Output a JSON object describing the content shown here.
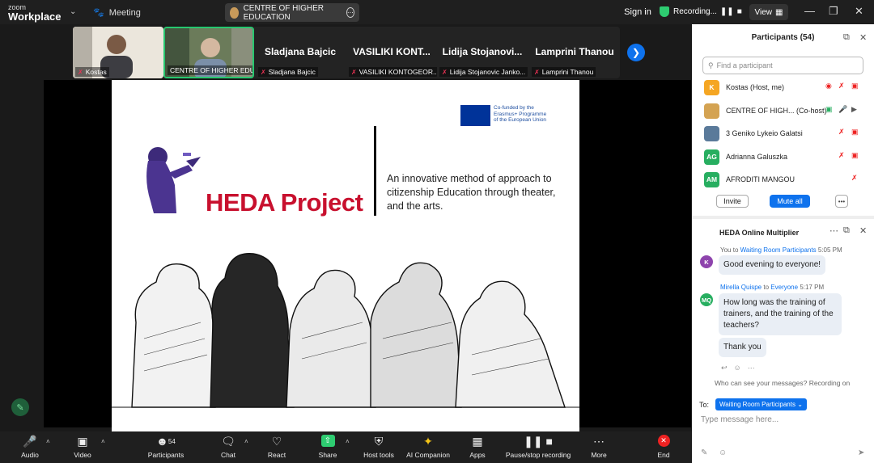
{
  "titlebar": {
    "brand_small": "zoom",
    "brand_big": "Workplace",
    "meeting_label": "Meeting",
    "tab_title": "CENTRE OF HIGHER EDUCATION",
    "sign_in": "Sign in",
    "recording": "Recording...",
    "view": "View"
  },
  "gallery": {
    "tiles": [
      {
        "name": "Kostas"
      },
      {
        "name": "CENTRE OF HIGHER EDU..."
      },
      {
        "label": "Sladjana Bajcic",
        "name": "Sladjana Bajcic"
      },
      {
        "label": "VASILIKI  KONT...",
        "name": "VASILIKI KONTOGEOR..."
      },
      {
        "label": "Lidija  Stojanovi...",
        "name": "Lidija Stojanovic Janko..."
      },
      {
        "label": "Lamprini Thanou",
        "name": "Lamprini Thanou"
      }
    ]
  },
  "slide": {
    "eu_text": [
      "Co-funded by the",
      "Erasmus+ Programme",
      "of the European Union"
    ],
    "title": "HEDA Project",
    "tagline": "An innovative method of approach to citizenship Education through theater, and the arts."
  },
  "participants": {
    "title": "Participants (54)",
    "search_placeholder": "Find a participant",
    "rows": [
      {
        "initials": "K",
        "name": "Kostas  (Host, me)",
        "color": "#f5a623"
      },
      {
        "initials": "",
        "name": "CENTRE OF HIGH...  (Co-host)",
        "color": "#d4a352"
      },
      {
        "initials": "",
        "name": "3 Geniko Lykeio Galatsi",
        "color": "#5a7a9a"
      },
      {
        "initials": "AG",
        "name": "Adrianna Galuszka",
        "color": "#27ae60"
      },
      {
        "initials": "AM",
        "name": "AFRODITI MANGOU",
        "color": "#27ae60"
      }
    ],
    "invite": "Invite",
    "mute_all": "Mute all",
    "more": "•••"
  },
  "chat": {
    "title": "HEDA Online Multiplier",
    "messages": [
      {
        "from": "You",
        "to_word": "to",
        "to": "Waiting Room Participants",
        "time": "5:05 PM",
        "text": "Good evening to everyone!",
        "initials": "K",
        "color": "#8e44ad"
      },
      {
        "from": "Mirella Quispe",
        "to_word": "to",
        "to": "Everyone",
        "time": "5:17 PM",
        "text": "How long was the training of trainers, and the training of the teachers?",
        "initials": "MQ",
        "color": "#27ae60"
      },
      {
        "text": "Thank you"
      }
    ],
    "who_can_see": "Who can see your messages? Recording on",
    "to_label": "To:",
    "to_value": "Waiting Room Participants",
    "input_placeholder": "Type message here..."
  },
  "toolbar": {
    "audio": "Audio",
    "video": "Video",
    "participants": "Participants",
    "participants_count": "54",
    "chat": "Chat",
    "react": "React",
    "share": "Share",
    "host_tools": "Host tools",
    "ai_companion": "AI Companion",
    "apps": "Apps",
    "pause_recording": "Pause/stop recording",
    "more": "More",
    "end": "End"
  },
  "colors": {
    "accent": "#0e72ed",
    "heda_red": "#c8102e",
    "share_green": "#2ecc71",
    "end_red": "#e22222"
  }
}
